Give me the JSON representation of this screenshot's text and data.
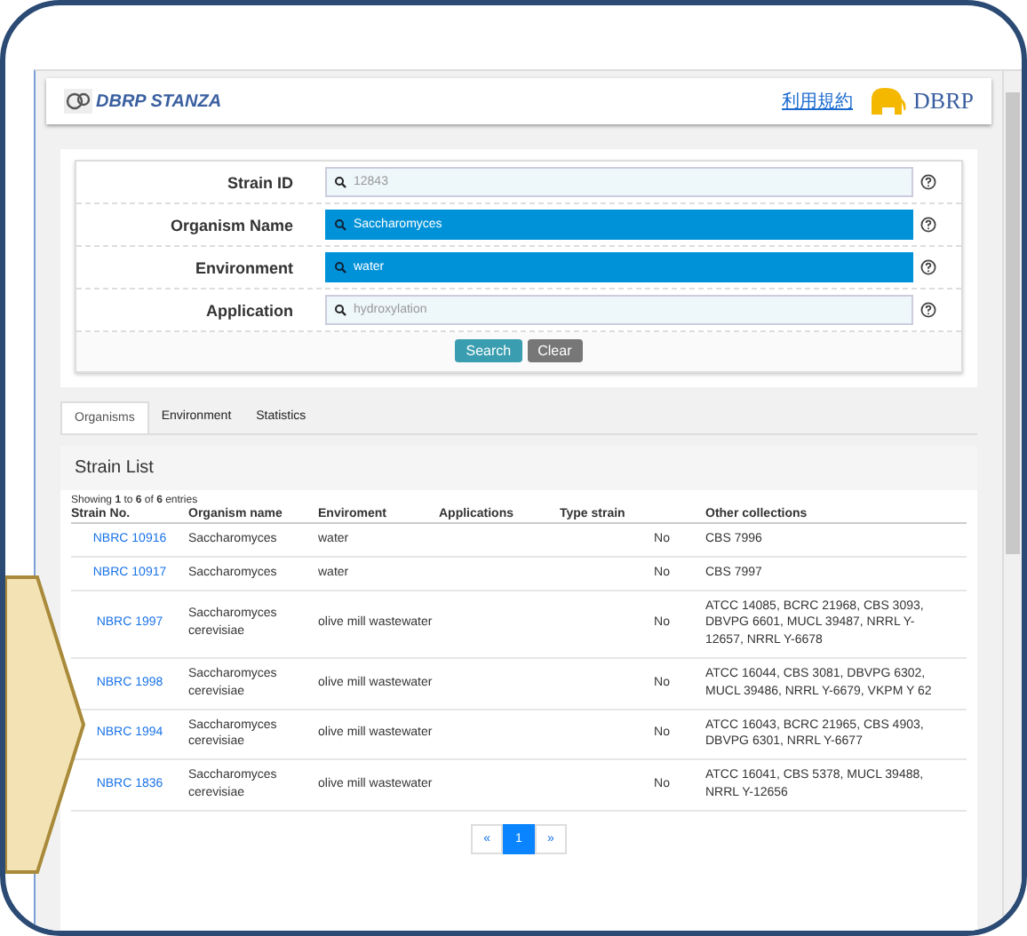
{
  "header": {
    "logo_text": "DBRP STANZA",
    "terms_link": "利用規約",
    "brand": "DBRP"
  },
  "search_form": {
    "fields": [
      {
        "label": "Strain ID",
        "placeholder": "12843",
        "highlighted": false
      },
      {
        "label": "Organism Name",
        "value": "Saccharomyces",
        "highlighted": true
      },
      {
        "label": "Environment",
        "value": "water",
        "highlighted": true
      },
      {
        "label": "Application",
        "placeholder": "hydroxylation",
        "highlighted": false
      }
    ],
    "buttons": [
      {
        "label": "Search",
        "kind": "primary"
      },
      {
        "label": "Clear",
        "kind": "secondary"
      }
    ]
  },
  "tabs": [
    {
      "label": "Organisms",
      "selected": true
    },
    {
      "label": "Environment",
      "selected": false
    },
    {
      "label": "Statistics",
      "selected": false
    }
  ],
  "strain_list": {
    "title": "Strain List",
    "info": "Showing **1** to **6** of **6** entries",
    "columns": [
      "Strain No.",
      "Organism name",
      "Enviroment",
      "Applications",
      "Type strain",
      "Other collections"
    ],
    "rows": [
      {
        "strain": "NBRC 10916",
        "organism": "Saccharomyces",
        "environment": "water",
        "type_strain": "No",
        "other": "CBS 7996"
      },
      {
        "strain": "NBRC 10917",
        "organism": "Saccharomyces",
        "environment": "water",
        "type_strain": "No",
        "other": "CBS 7997"
      },
      {
        "strain": "NBRC 1997",
        "organism": "Saccharomyces cerevisiae",
        "environment": "olive mill wastewater",
        "type_strain": "No",
        "other": "ATCC 14085, BCRC 21968, CBS 3093, DBVPG 6601, MUCL 39487, NRRL Y-12657, NRRL Y-6678"
      },
      {
        "strain": "NBRC 1998",
        "organism": "Saccharomyces cerevisiae",
        "environment": "olive mill wastewater",
        "type_strain": "No",
        "other": "ATCC 16044, CBS 3081, DBVPG 6302, MUCL 39486, NRRL Y-6679, VKPM Y 62"
      },
      {
        "strain": "NBRC 1994",
        "organism": "Saccharomyces cerevisiae",
        "environment": "olive mill wastewater",
        "type_strain": "No",
        "other": "ATCC 16043, BCRC 21965, CBS 4903, DBVPG 6301, NRRL Y-6677"
      },
      {
        "strain": "NBRC 1836",
        "organism": "Saccharomyces cerevisiae",
        "environment": "olive mill wastewater",
        "type_strain": "No",
        "other": "ATCC 16041, CBS 5378, MUCL 39488, NRRL Y-12656"
      }
    ]
  },
  "pagination": [
    {
      "label": "«",
      "selected": false
    },
    {
      "label": "1",
      "selected": true
    },
    {
      "label": "»",
      "selected": false
    }
  ]
}
